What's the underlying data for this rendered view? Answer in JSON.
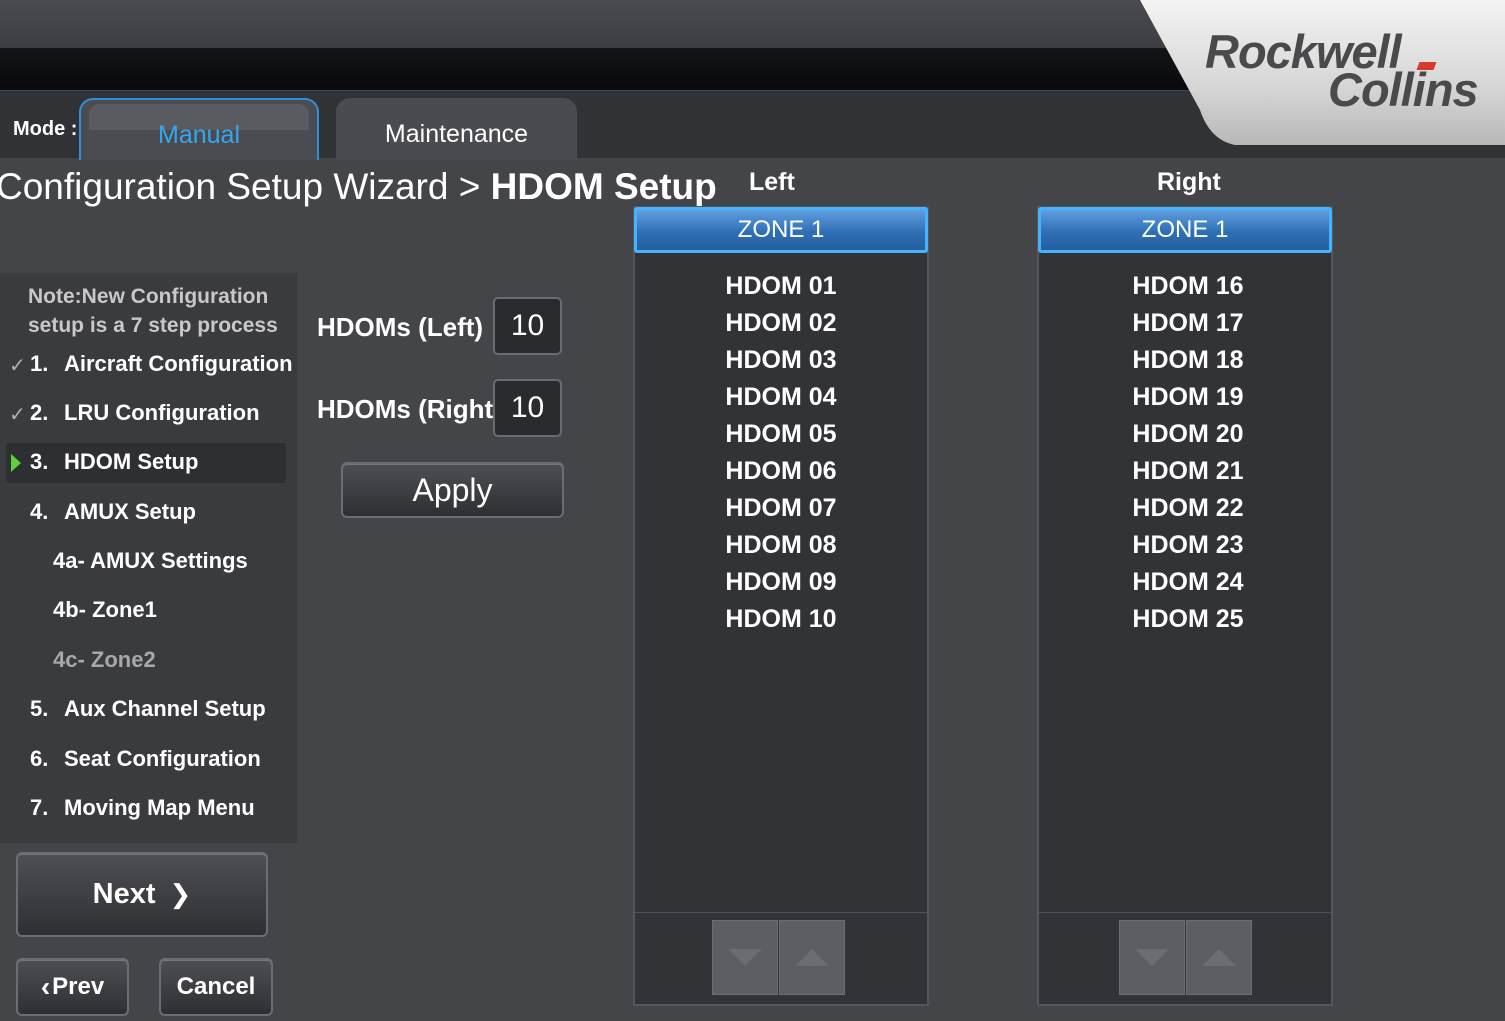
{
  "brand": {
    "line1": "Rockwell",
    "line2": "Collins"
  },
  "mode": {
    "label": "Mode :",
    "tabs": [
      {
        "label": "Manual",
        "active": true
      },
      {
        "label": "Maintenance",
        "active": false
      }
    ]
  },
  "breadcrumb": {
    "parent": "Configuration Setup Wizard >",
    "current": "HDOM Setup"
  },
  "wizard": {
    "note_line1": "Note:New Configuration",
    "note_line2": "setup is a 7 step process",
    "steps": [
      {
        "num": "1.",
        "label": "Aircraft Configuration",
        "status": "done"
      },
      {
        "num": "2.",
        "label": "LRU Configuration",
        "status": "done"
      },
      {
        "num": "3.",
        "label": "HDOM Setup",
        "status": "current"
      },
      {
        "num": "4.",
        "label": "AMUX Setup",
        "status": "pending"
      },
      {
        "num": "",
        "label": "4a- AMUX Settings",
        "status": "pending"
      },
      {
        "num": "",
        "label": "4b- Zone1",
        "status": "pending"
      },
      {
        "num": "",
        "label": "4c- Zone2",
        "status": "disabled"
      },
      {
        "num": "5.",
        "label": "Aux Channel Setup",
        "status": "pending"
      },
      {
        "num": "6.",
        "label": "Seat Configuration",
        "status": "pending"
      },
      {
        "num": "7.",
        "label": "Moving Map Menu",
        "status": "pending"
      }
    ],
    "check_glyph": "✓"
  },
  "hdom_inputs": {
    "left_label": "HDOMs (Left)",
    "left_value": "10",
    "right_label": "HDOMs (Right)",
    "right_value": "10",
    "apply_label": "Apply"
  },
  "nav": {
    "next_label": "Next",
    "next_glyph": "❯",
    "prev_glyph": "‹",
    "prev_label": "Prev",
    "cancel_label": "Cancel"
  },
  "left_panel": {
    "heading": "Left",
    "zone": "ZONE 1",
    "items": [
      "HDOM 01",
      "HDOM 02",
      "HDOM 03",
      "HDOM 04",
      "HDOM 05",
      "HDOM 06",
      "HDOM 07",
      "HDOM 08",
      "HDOM 09",
      "HDOM 10"
    ]
  },
  "right_panel": {
    "heading": "Right",
    "zone": "ZONE 1",
    "items": [
      "HDOM 16",
      "HDOM 17",
      "HDOM 18",
      "HDOM 19",
      "HDOM 20",
      "HDOM 21",
      "HDOM 22",
      "HDOM 23",
      "HDOM 24",
      "HDOM 25"
    ]
  },
  "colors": {
    "accent": "#35a7ef",
    "zone_blue": "#2f6fb5",
    "current_marker": "#5bd23c"
  }
}
